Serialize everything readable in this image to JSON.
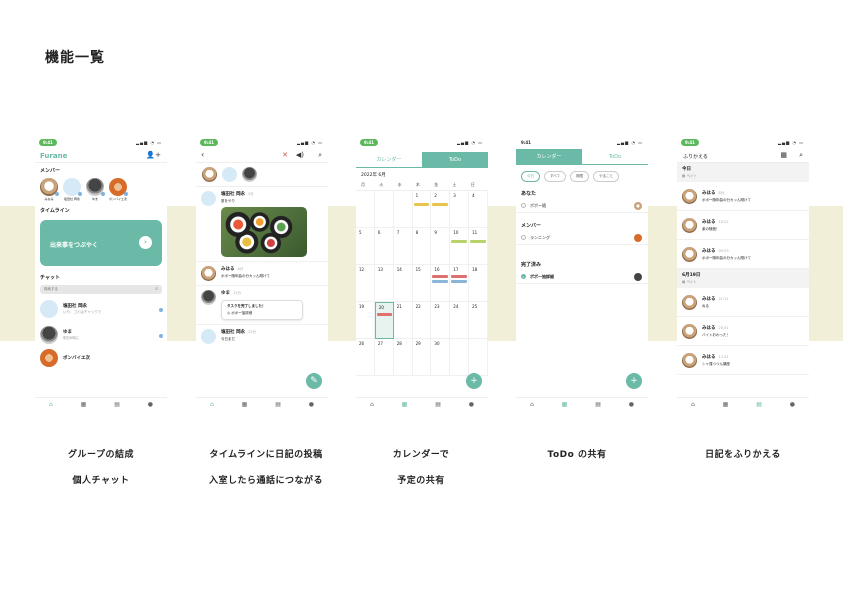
{
  "page_title": "機能一覧",
  "screens": {
    "groups": {
      "status_time": "9:41",
      "logo": "Furane",
      "members_heading": "メンバー",
      "members": [
        "みなみ",
        "塩田社 岡永",
        "ゆま",
        "ボンバイエ次"
      ],
      "timeline_heading": "タイムライン",
      "cta_label": "出来事をつぶやく",
      "chat_heading": "チャット",
      "search_placeholder": "検索する",
      "chats": [
        {
          "name": "塩田社 岡永",
          "snippet": "いや、ゴミはチャックで"
        },
        {
          "name": "ゆま",
          "snippet": "明日6時に"
        },
        {
          "name": "ボンバイエ次",
          "snippet": ""
        }
      ]
    },
    "timeline": {
      "status_time": "9:41",
      "posts": [
        {
          "name": "塩田社 岡永",
          "time": "2分",
          "text": "夏をやり"
        },
        {
          "name": "みはる",
          "time": "8分",
          "text": "ポポー随年曲の分カッん剛けて"
        },
        {
          "name": "ゆま",
          "time": "12分",
          "text": ""
        },
        {
          "name": "塩田社 岡永",
          "time": "32分",
          "text": "今日まだ"
        }
      ],
      "task_note_title": "タスクを完了しました！",
      "task_note_item": "ポポー抽詳細"
    },
    "calendar": {
      "status_time": "9:41",
      "tab_calendar": "カレンダー",
      "tab_todo": "ToDo",
      "month_label": "2022年 6月",
      "weekdays": [
        "月",
        "火",
        "水",
        "木",
        "金",
        "土",
        "日"
      ],
      "days": [
        "",
        "",
        "",
        "1",
        "2",
        "3",
        "4",
        "5",
        "6",
        "7",
        "8",
        "9",
        "10",
        "11",
        "12",
        "13",
        "14",
        "15",
        "16",
        "17",
        "18",
        "19",
        "20",
        "21",
        "22",
        "23",
        "24",
        "25",
        "26",
        "27",
        "28",
        "29",
        "30",
        "",
        ""
      ]
    },
    "todo": {
      "status_time": "9:41",
      "tab_calendar": "カレンダー",
      "tab_todo": "ToDo",
      "filters": [
        "今日",
        "すべて",
        "期限",
        "やること"
      ],
      "section_you": "あなた",
      "item_you": "ポポー随",
      "section_members": "メンバー",
      "item_member": "ランニング",
      "section_done": "完了済み",
      "item_done": "ポポー抽詳細"
    },
    "journal": {
      "status_time": "9:41",
      "header_title": "ふりかえる",
      "today_label": "今日",
      "today_sub": "ベイト",
      "today_entries": [
        {
          "name": "みはる",
          "time": "8分",
          "text": "ポポー随年曲の分カッん剛けて"
        },
        {
          "name": "みはる",
          "time": "10:22",
          "text": "楽の随音！"
        },
        {
          "name": "みはる",
          "time": "09:23",
          "text": "ポポー随年曲の分カッん剛けて"
        }
      ],
      "prev_day_label": "6月19日",
      "prev_day_sub": "ベイト",
      "prev_entries": [
        {
          "name": "みはる",
          "time": "21:11",
          "text": "ねる"
        },
        {
          "name": "みはる",
          "time": "20:31",
          "text": "バイトおわった！"
        },
        {
          "name": "みはる",
          "time": "17:41",
          "text": "シャ運つつん講座"
        }
      ]
    }
  },
  "captions": [
    {
      "line1": "グループの結成",
      "line2": "個人チャット"
    },
    {
      "line1": "タイムラインに日記の投稿",
      "line2": "入室したら通話につながる"
    },
    {
      "line1": "カレンダーで",
      "line2": "予定の共有"
    },
    {
      "line1": "ToDo の共有",
      "line2": ""
    },
    {
      "line1": "日記をふりかえる",
      "line2": ""
    }
  ],
  "colors": {
    "accent": "#6bbaa7",
    "band": "#f1efd8",
    "status_pill": "#5cb85c"
  }
}
